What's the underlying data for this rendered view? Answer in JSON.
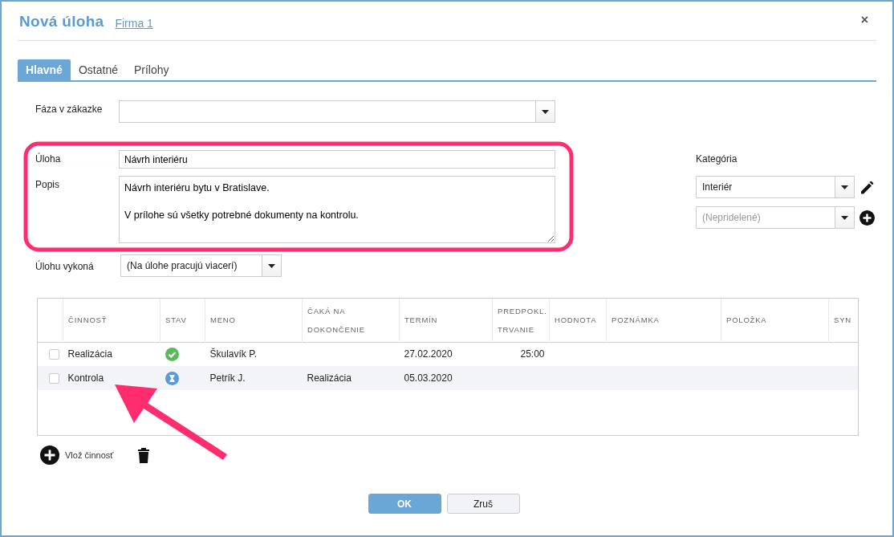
{
  "window": {
    "title": "Nová úloha",
    "company_link": "Firma 1",
    "close": "×"
  },
  "tabs": [
    {
      "label": "Hlavné",
      "selected": true
    },
    {
      "label": "Ostatné",
      "selected": false
    },
    {
      "label": "Prílohy",
      "selected": false
    }
  ],
  "form": {
    "phase": {
      "label": "Fáza v zákazke"
    },
    "task": {
      "label": "Úloha",
      "value": "Návrh interiéru"
    },
    "description": {
      "label": "Popis",
      "value": "Návrh interiéru bytu v Bratislave.\n\nV prílohe sú všetky potrebné dokumenty na kontrolu."
    },
    "assignee": {
      "label": "Úlohu vykoná",
      "value": "(Na úlohe pracujú viacerí)"
    },
    "category": {
      "label": "Kategória",
      "selects": [
        {
          "kind": "edit",
          "value": "Interiér"
        },
        {
          "kind": "add",
          "placeholder": "(Nepridelené)"
        }
      ]
    }
  },
  "table": {
    "columns": [
      {
        "label": "ČINNOSŤ"
      },
      {
        "label": "STAV"
      },
      {
        "label": "MENO"
      },
      {
        "label": "ČAKÁ NA DOKONČENIE"
      },
      {
        "label": "TERMÍN"
      },
      {
        "label": "PREDPOKL. TRVANIE"
      },
      {
        "label": "HODNOTA"
      },
      {
        "label": "POZNÁMKA"
      },
      {
        "label": "POLOŽKA"
      },
      {
        "label": "SYN"
      }
    ],
    "rows": [
      {
        "checked": false,
        "selected": false,
        "kind": "done",
        "activity": "Realizácia",
        "name": "Škulavík P.",
        "deadline": "27.02.2020",
        "duration": "25:00"
      },
      {
        "checked": false,
        "selected": true,
        "kind": "waiting",
        "activity": "Kontrola",
        "name": "Petrík J.",
        "waits_for": "Realizácia",
        "deadline": "05.03.2020"
      }
    ]
  },
  "add_activity": "Vlož činnosť",
  "buttons": [
    {
      "kind": "primary",
      "label": "OK"
    },
    {
      "kind": "secondary",
      "label": "Zruš"
    }
  ]
}
